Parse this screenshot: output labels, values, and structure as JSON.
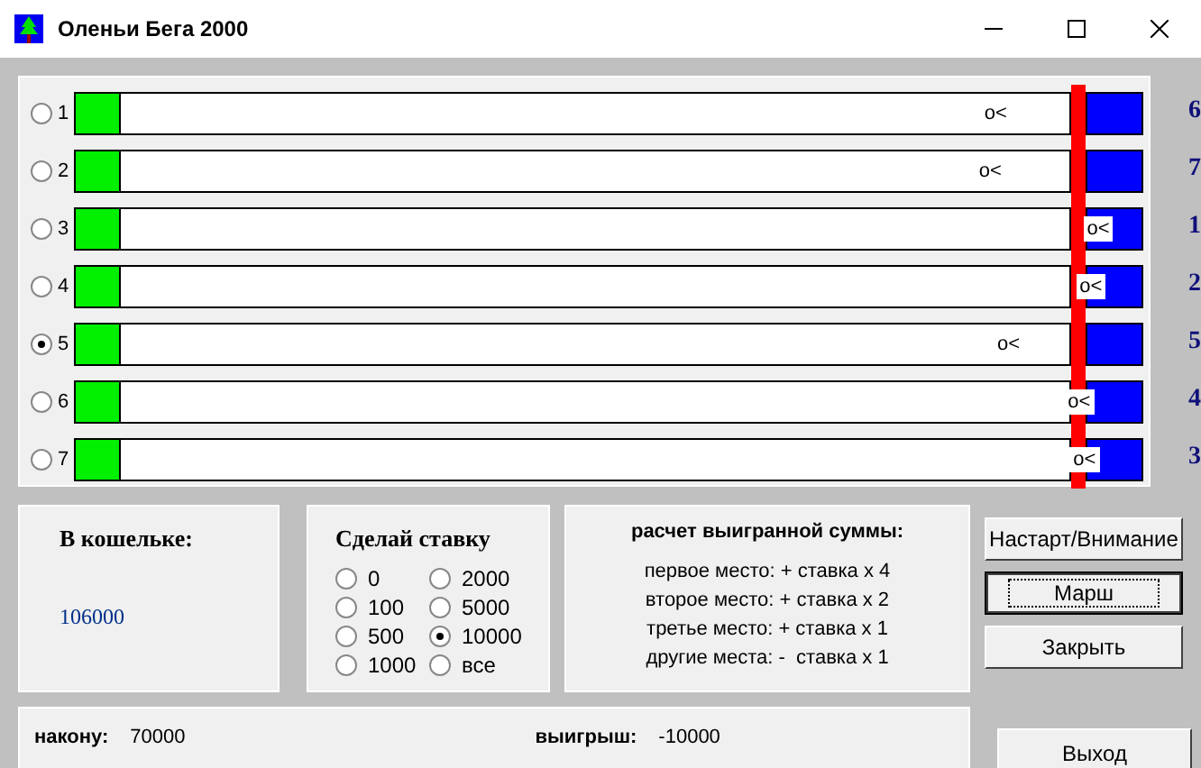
{
  "window": {
    "title": "Оленьи Бега 2000"
  },
  "lanes": [
    {
      "number": "1",
      "selected": false,
      "deer": "o<",
      "level": 0.848,
      "place": "6"
    },
    {
      "number": "2",
      "selected": false,
      "deer": "o<",
      "level": 0.843,
      "place": "7"
    },
    {
      "number": "3",
      "selected": false,
      "deer": "o<",
      "level": 0.944,
      "place": "1"
    },
    {
      "number": "4",
      "selected": false,
      "deer": "o<",
      "level": 0.937,
      "place": "2"
    },
    {
      "number": "5",
      "selected": true,
      "deer": "o<",
      "level": 0.86,
      "place": "5"
    },
    {
      "number": "6",
      "selected": false,
      "deer": "o<",
      "level": 0.926,
      "place": "4"
    },
    {
      "number": "7",
      "selected": false,
      "deer": "o<",
      "level": 0.931,
      "place": "3"
    }
  ],
  "wallet": {
    "label": "В кошельке:",
    "amount": "106000"
  },
  "bet": {
    "title": "Сделай ставку",
    "options": [
      {
        "label": "0",
        "selected": false
      },
      {
        "label": "100",
        "selected": false
      },
      {
        "label": "500",
        "selected": false
      },
      {
        "label": "1000",
        "selected": false
      },
      {
        "label": "2000",
        "selected": false
      },
      {
        "label": "5000",
        "selected": false
      },
      {
        "label": "10000",
        "selected": true
      },
      {
        "label": "все",
        "selected": false
      }
    ]
  },
  "payout": {
    "title": "расчет выигранной суммы:",
    "lines": [
      "первое место: + ставка x 4",
      "второе место: + ставка x 2",
      "третье место: + ставка x 1",
      "другие места: -  ставка x 1"
    ]
  },
  "buttons": [
    {
      "label": "Настарт/Внимание",
      "focused": false
    },
    {
      "label": "Марш",
      "focused": true
    },
    {
      "label": "Закрыть",
      "focused": false
    }
  ],
  "status": {
    "stake_label": "накону:",
    "stake": "70000",
    "win_label": "выигрыш:",
    "win": "-10000"
  },
  "exit_button": {
    "label": "Выход"
  }
}
